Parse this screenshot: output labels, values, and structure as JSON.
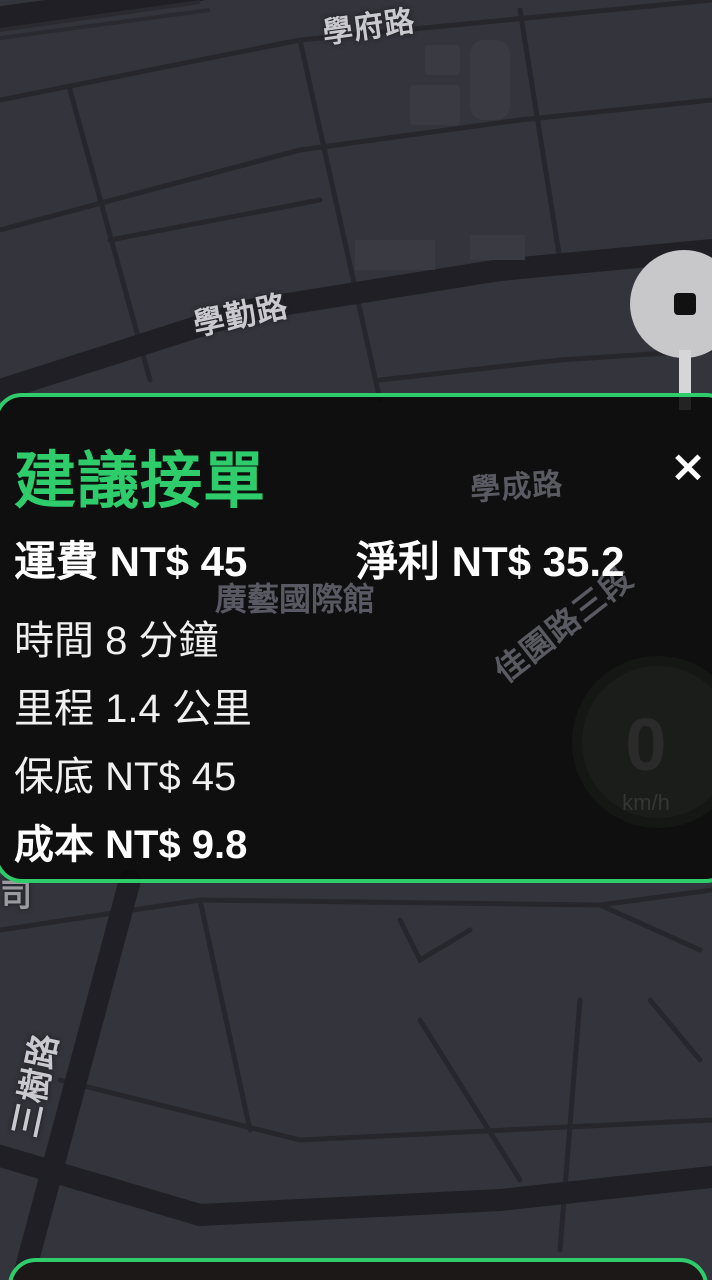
{
  "map": {
    "road_labels": [
      "學府路",
      "學勤路",
      "學成路",
      "佳園路三段",
      "三樹路",
      "司"
    ],
    "poi_label": "廣藝國際館"
  },
  "speedometer": {
    "value": "0",
    "unit": "km/h"
  },
  "suggestion_card": {
    "title": "建議接單",
    "close_symbol": "×",
    "fare": "運費 NT$ 45",
    "net_profit": "淨利 NT$ 35.2",
    "time": "時間 8 分鐘",
    "distance": "里程 1.4 公里",
    "guarantee": "保底 NT$ 45",
    "cost": "成本 NT$ 9.8"
  },
  "icons": {
    "destination_pin": "location-pin-icon",
    "close": "close-icon"
  },
  "colors": {
    "accent": "#2ecc6a",
    "map_background": "#34343c",
    "road": "#222228"
  }
}
